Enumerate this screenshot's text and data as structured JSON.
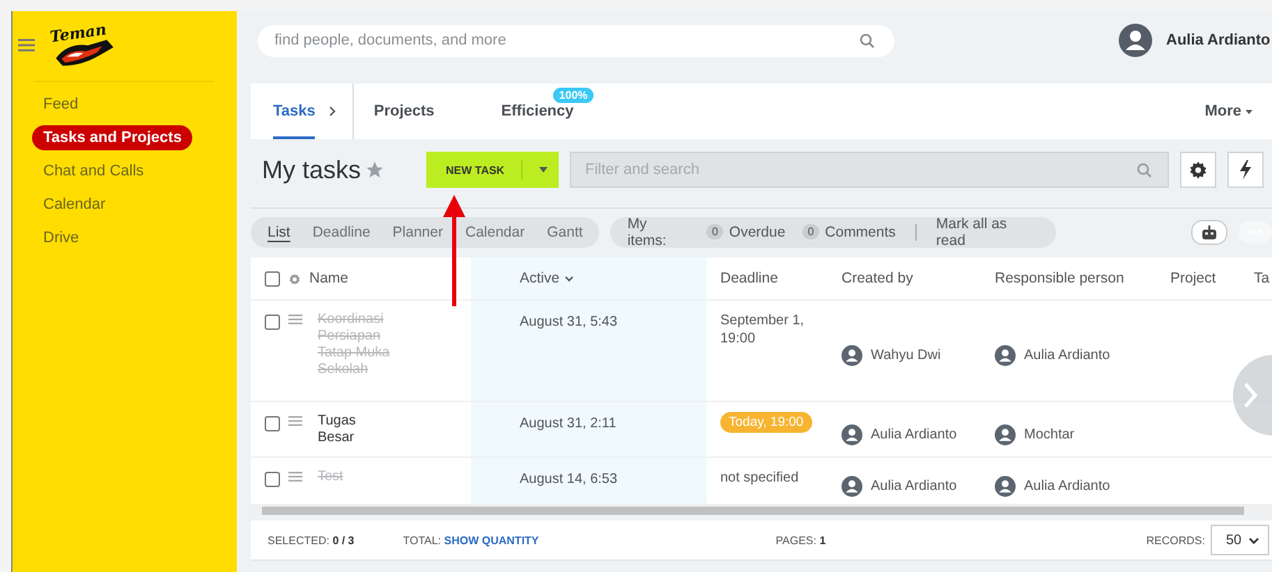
{
  "sidebar": {
    "logo_text": "Teman",
    "items": [
      {
        "label": "Feed",
        "selected": false
      },
      {
        "label": "Tasks and Projects",
        "selected": true
      },
      {
        "label": "Chat and Calls",
        "selected": false
      },
      {
        "label": "Calendar",
        "selected": false
      },
      {
        "label": "Drive",
        "selected": false
      }
    ]
  },
  "header": {
    "search": {
      "placeholder": "find people, documents, and more"
    },
    "user": {
      "name": "Aulia Ardianto"
    }
  },
  "tabs": [
    {
      "label": "Tasks",
      "selected": true
    },
    {
      "label": "Projects",
      "selected": false
    },
    {
      "label": "Efficiency",
      "selected": false,
      "badge": "100%"
    }
  ],
  "more": "More",
  "title": "My tasks",
  "new_task": "NEW TASK",
  "filter": {
    "placeholder": "Filter and search"
  },
  "views": [
    {
      "label": "List",
      "selected": true
    },
    {
      "label": "Deadline",
      "selected": false
    },
    {
      "label": "Planner",
      "selected": false
    },
    {
      "label": "Calendar",
      "selected": false
    },
    {
      "label": "Gantt",
      "selected": false
    }
  ],
  "my_items": {
    "label": "My items:",
    "counters": [
      {
        "count": "0",
        "label": "Overdue"
      },
      {
        "count": "0",
        "label": "Comments"
      }
    ],
    "mark_read": "Mark all as read"
  },
  "table": {
    "select_all_checked": false,
    "columns": [
      "Name",
      "Active",
      "Deadline",
      "Created by",
      "Responsible person",
      "Project",
      "Ta"
    ],
    "rows": [
      {
        "checked": false,
        "name": "Koordinasi Persiapan Tatap Muka Sekolah",
        "completed": true,
        "active": "August 31, 5:43",
        "deadline": {
          "kind": "text",
          "text": "September 1, 19:00"
        },
        "created_by": "Wahyu Dwi",
        "responsible": "Aulia Ardianto"
      },
      {
        "checked": false,
        "name": "Tugas Besar",
        "completed": false,
        "active": "August 31, 2:11",
        "deadline": {
          "kind": "badge",
          "text": "Today, 19:00"
        },
        "created_by": "Aulia Ardianto",
        "responsible": "Mochtar"
      },
      {
        "checked": false,
        "name": "Test",
        "completed": true,
        "active": "August 14, 6:53",
        "deadline": {
          "kind": "text",
          "text": "not specified"
        },
        "created_by": "Aulia Ardianto",
        "responsible": "Aulia Ardianto"
      }
    ]
  },
  "footer": {
    "selected_label": "SELECTED:",
    "selected": "0 / 3",
    "total_label": "TOTAL:",
    "total_link": "SHOW QUANTITY",
    "pages_label": "PAGES:",
    "pages": "1",
    "records_label": "RECORDS:",
    "records": "50"
  }
}
